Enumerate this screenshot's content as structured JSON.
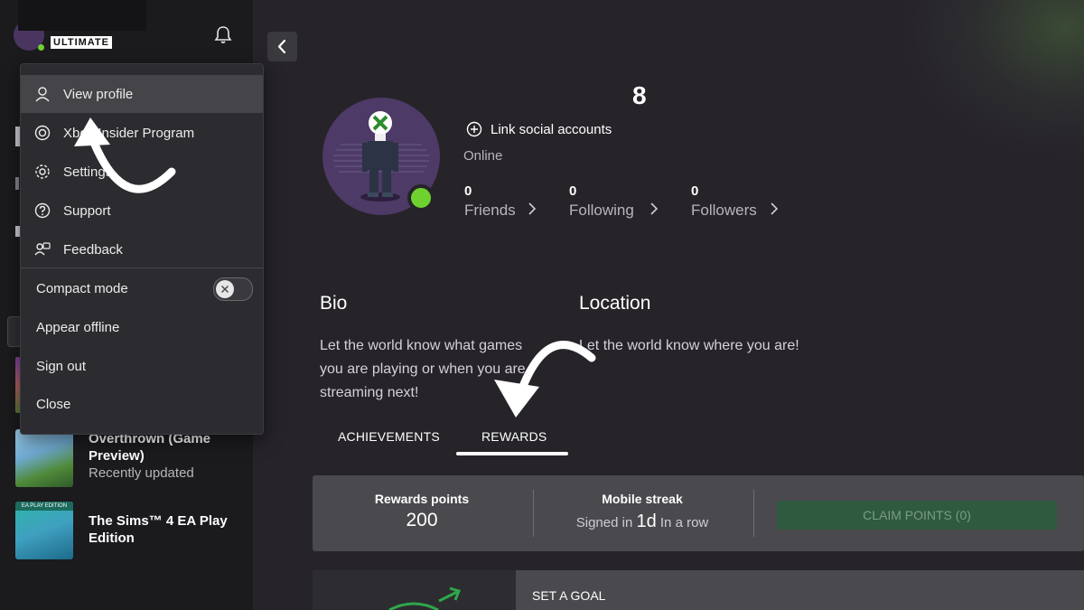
{
  "sidebar": {
    "badge": "ULTIMATE",
    "games": [
      {
        "title": "Overthrown (Game Preview)",
        "subtitle": "Recently updated"
      },
      {
        "title": "The Sims™ 4 EA Play Edition",
        "subtitle": ""
      }
    ],
    "sims_band": "EA PLAY EDITION"
  },
  "menu": {
    "items": [
      {
        "label": "View profile",
        "icon": "person-icon"
      },
      {
        "label": "Xbox Insider Program",
        "icon": "insider-icon"
      },
      {
        "label": "Settings",
        "icon": "gear-icon"
      },
      {
        "label": "Support",
        "icon": "help-icon"
      },
      {
        "label": "Feedback",
        "icon": "feedback-icon"
      }
    ],
    "compact_mode": "Compact mode",
    "compact_mode_on": false,
    "appear_offline": "Appear offline",
    "sign_out": "Sign out",
    "close": "Close"
  },
  "profile": {
    "gamertag_suffix": "8",
    "link_social": "Link social accounts",
    "status": "Online",
    "stats": [
      {
        "count": "0",
        "label": "Friends"
      },
      {
        "count": "0",
        "label": "Following"
      },
      {
        "count": "0",
        "label": "Followers"
      }
    ]
  },
  "bio": {
    "heading": "Bio",
    "text": "Let the world know what games you are playing or when you are streaming next!"
  },
  "location": {
    "heading": "Location",
    "text": "Let the world know where you are!"
  },
  "tabs": [
    {
      "label": "ACHIEVEMENTS",
      "active": false
    },
    {
      "label": "REWARDS",
      "active": true
    }
  ],
  "rewards": {
    "points_title": "Rewards points",
    "points_value": "200",
    "streak_title": "Mobile streak",
    "streak_prefix": "Signed in",
    "streak_days": "1d",
    "streak_suffix": "In a row",
    "claim_button": "CLAIM POINTS (0)"
  },
  "goal": {
    "title": "SET A GOAL"
  },
  "colors": {
    "online": "#6fd12f",
    "claim_bg": "#2f5a3f",
    "avatar_bg": "#4d3a66"
  }
}
